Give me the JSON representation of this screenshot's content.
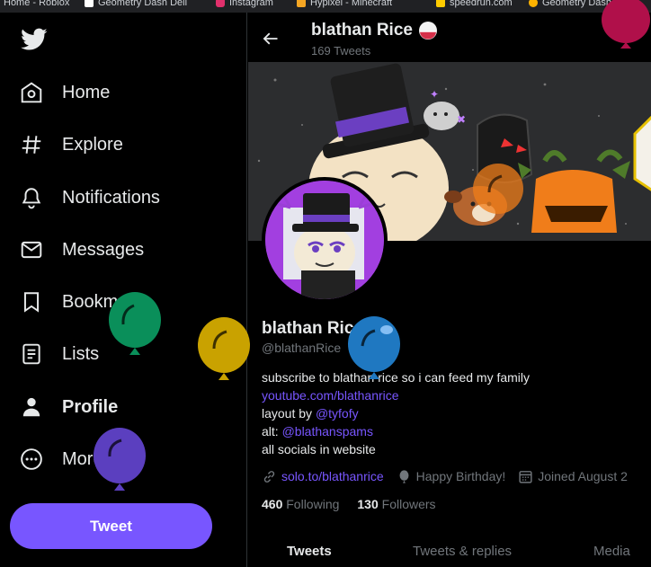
{
  "bookmarks": [
    {
      "label": "Home - Roblox",
      "color": "#e0e0e0"
    },
    {
      "label": "Geometry Dash Deli",
      "color": "#ffffff"
    },
    {
      "label": "Instagram",
      "color": "#e1306c"
    },
    {
      "label": "Hypixel - Minecraft",
      "color": "#f5a623"
    },
    {
      "label": "speedrun.com",
      "color": "#ffcc00"
    },
    {
      "label": "Geometry Dash Brow",
      "color": "#ffb300"
    }
  ],
  "nav": {
    "items": [
      {
        "label": "Home",
        "icon": "home-icon"
      },
      {
        "label": "Explore",
        "icon": "hashtag-icon"
      },
      {
        "label": "Notifications",
        "icon": "bell-icon"
      },
      {
        "label": "Messages",
        "icon": "envelope-icon"
      },
      {
        "label": "Bookmarks",
        "icon": "bookmark-icon"
      },
      {
        "label": "Lists",
        "icon": "list-icon"
      },
      {
        "label": "Profile",
        "icon": "person-icon"
      },
      {
        "label": "More",
        "icon": "more-icon"
      }
    ],
    "active": "Profile",
    "tweet_button": "Tweet"
  },
  "header": {
    "name": "blathan Rice",
    "tweet_count": "169 Tweets"
  },
  "profile": {
    "name": "blathan Rice",
    "handle": "@blathanRice",
    "bio": {
      "line1": "subscribe to blathan rice so i can feed my family",
      "youtube_link": "youtube.com/blathanrice",
      "layout_prefix": "layout by ",
      "layout_mention": "@tyfofy",
      "alt_prefix": "alt: ",
      "alt_mention": "@blathanspams",
      "line5": "all socials in website"
    },
    "website": "solo.to/blathanrice",
    "birthday": "Happy Birthday!",
    "joined": "Joined August 2",
    "following_count": "460",
    "following_label": "Following",
    "followers_count": "130",
    "followers_label": "Followers"
  },
  "tabs": [
    "Tweets",
    "Tweets & replies",
    "Media"
  ],
  "active_tab": "Tweets",
  "colors": {
    "accent": "#7856ff",
    "balloons": [
      "#0a8f5a",
      "#c9a200",
      "#1f78c1",
      "#5b3fbf",
      "#b0104a"
    ]
  }
}
